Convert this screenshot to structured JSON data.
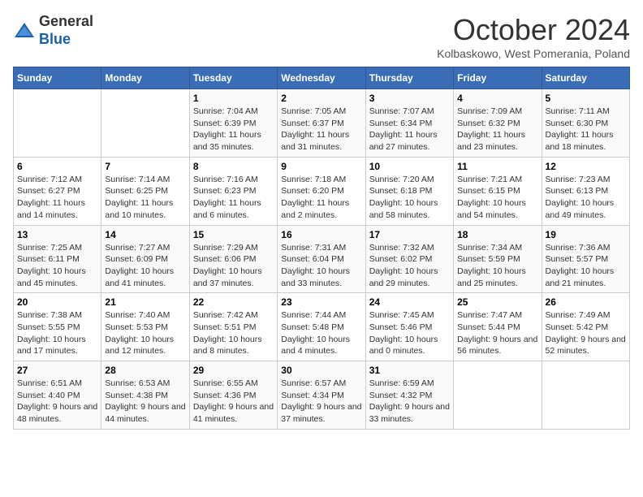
{
  "header": {
    "logo_line1": "General",
    "logo_line2": "Blue",
    "month": "October 2024",
    "location": "Kolbaskowo, West Pomerania, Poland"
  },
  "days_of_week": [
    "Sunday",
    "Monday",
    "Tuesday",
    "Wednesday",
    "Thursday",
    "Friday",
    "Saturday"
  ],
  "weeks": [
    [
      {
        "day": "",
        "detail": ""
      },
      {
        "day": "",
        "detail": ""
      },
      {
        "day": "1",
        "detail": "Sunrise: 7:04 AM\nSunset: 6:39 PM\nDaylight: 11 hours and 35 minutes."
      },
      {
        "day": "2",
        "detail": "Sunrise: 7:05 AM\nSunset: 6:37 PM\nDaylight: 11 hours and 31 minutes."
      },
      {
        "day": "3",
        "detail": "Sunrise: 7:07 AM\nSunset: 6:34 PM\nDaylight: 11 hours and 27 minutes."
      },
      {
        "day": "4",
        "detail": "Sunrise: 7:09 AM\nSunset: 6:32 PM\nDaylight: 11 hours and 23 minutes."
      },
      {
        "day": "5",
        "detail": "Sunrise: 7:11 AM\nSunset: 6:30 PM\nDaylight: 11 hours and 18 minutes."
      }
    ],
    [
      {
        "day": "6",
        "detail": "Sunrise: 7:12 AM\nSunset: 6:27 PM\nDaylight: 11 hours and 14 minutes."
      },
      {
        "day": "7",
        "detail": "Sunrise: 7:14 AM\nSunset: 6:25 PM\nDaylight: 11 hours and 10 minutes."
      },
      {
        "day": "8",
        "detail": "Sunrise: 7:16 AM\nSunset: 6:23 PM\nDaylight: 11 hours and 6 minutes."
      },
      {
        "day": "9",
        "detail": "Sunrise: 7:18 AM\nSunset: 6:20 PM\nDaylight: 11 hours and 2 minutes."
      },
      {
        "day": "10",
        "detail": "Sunrise: 7:20 AM\nSunset: 6:18 PM\nDaylight: 10 hours and 58 minutes."
      },
      {
        "day": "11",
        "detail": "Sunrise: 7:21 AM\nSunset: 6:15 PM\nDaylight: 10 hours and 54 minutes."
      },
      {
        "day": "12",
        "detail": "Sunrise: 7:23 AM\nSunset: 6:13 PM\nDaylight: 10 hours and 49 minutes."
      }
    ],
    [
      {
        "day": "13",
        "detail": "Sunrise: 7:25 AM\nSunset: 6:11 PM\nDaylight: 10 hours and 45 minutes."
      },
      {
        "day": "14",
        "detail": "Sunrise: 7:27 AM\nSunset: 6:09 PM\nDaylight: 10 hours and 41 minutes."
      },
      {
        "day": "15",
        "detail": "Sunrise: 7:29 AM\nSunset: 6:06 PM\nDaylight: 10 hours and 37 minutes."
      },
      {
        "day": "16",
        "detail": "Sunrise: 7:31 AM\nSunset: 6:04 PM\nDaylight: 10 hours and 33 minutes."
      },
      {
        "day": "17",
        "detail": "Sunrise: 7:32 AM\nSunset: 6:02 PM\nDaylight: 10 hours and 29 minutes."
      },
      {
        "day": "18",
        "detail": "Sunrise: 7:34 AM\nSunset: 5:59 PM\nDaylight: 10 hours and 25 minutes."
      },
      {
        "day": "19",
        "detail": "Sunrise: 7:36 AM\nSunset: 5:57 PM\nDaylight: 10 hours and 21 minutes."
      }
    ],
    [
      {
        "day": "20",
        "detail": "Sunrise: 7:38 AM\nSunset: 5:55 PM\nDaylight: 10 hours and 17 minutes."
      },
      {
        "day": "21",
        "detail": "Sunrise: 7:40 AM\nSunset: 5:53 PM\nDaylight: 10 hours and 12 minutes."
      },
      {
        "day": "22",
        "detail": "Sunrise: 7:42 AM\nSunset: 5:51 PM\nDaylight: 10 hours and 8 minutes."
      },
      {
        "day": "23",
        "detail": "Sunrise: 7:44 AM\nSunset: 5:48 PM\nDaylight: 10 hours and 4 minutes."
      },
      {
        "day": "24",
        "detail": "Sunrise: 7:45 AM\nSunset: 5:46 PM\nDaylight: 10 hours and 0 minutes."
      },
      {
        "day": "25",
        "detail": "Sunrise: 7:47 AM\nSunset: 5:44 PM\nDaylight: 9 hours and 56 minutes."
      },
      {
        "day": "26",
        "detail": "Sunrise: 7:49 AM\nSunset: 5:42 PM\nDaylight: 9 hours and 52 minutes."
      }
    ],
    [
      {
        "day": "27",
        "detail": "Sunrise: 6:51 AM\nSunset: 4:40 PM\nDaylight: 9 hours and 48 minutes."
      },
      {
        "day": "28",
        "detail": "Sunrise: 6:53 AM\nSunset: 4:38 PM\nDaylight: 9 hours and 44 minutes."
      },
      {
        "day": "29",
        "detail": "Sunrise: 6:55 AM\nSunset: 4:36 PM\nDaylight: 9 hours and 41 minutes."
      },
      {
        "day": "30",
        "detail": "Sunrise: 6:57 AM\nSunset: 4:34 PM\nDaylight: 9 hours and 37 minutes."
      },
      {
        "day": "31",
        "detail": "Sunrise: 6:59 AM\nSunset: 4:32 PM\nDaylight: 9 hours and 33 minutes."
      },
      {
        "day": "",
        "detail": ""
      },
      {
        "day": "",
        "detail": ""
      }
    ]
  ]
}
